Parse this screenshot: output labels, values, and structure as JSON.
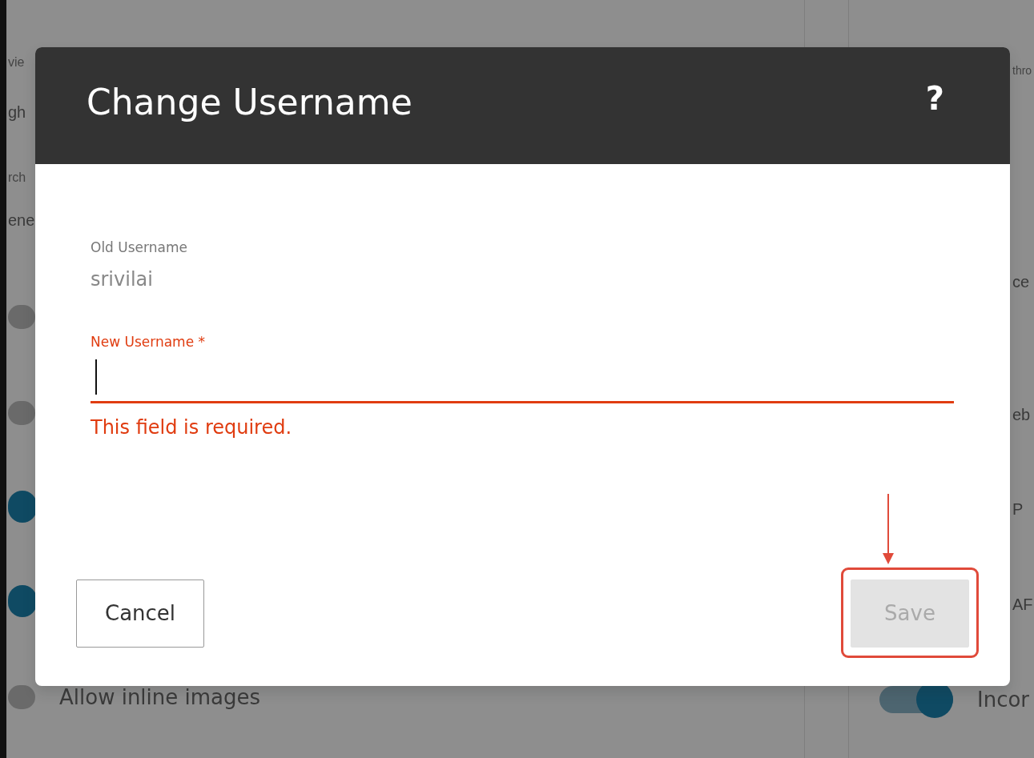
{
  "background": {
    "left_items": [
      {
        "kind": "caption",
        "text": "vie"
      },
      {
        "kind": "text",
        "text": "gh"
      },
      {
        "kind": "caption",
        "text": "rch"
      },
      {
        "kind": "text",
        "text": "ene"
      },
      {
        "kind": "toggle",
        "on": false
      },
      {
        "kind": "toggle",
        "on": false
      },
      {
        "kind": "toggle",
        "on": true
      },
      {
        "kind": "toggle",
        "on": true
      },
      {
        "kind": "toggle",
        "on": false,
        "label": "Allow inline images"
      }
    ],
    "right_items": [
      {
        "kind": "caption",
        "text": "thro"
      },
      {
        "kind": "text",
        "text": "ce"
      },
      {
        "kind": "text",
        "text": "eb"
      },
      {
        "kind": "text",
        "text": "P"
      },
      {
        "kind": "text",
        "text": "AF"
      },
      {
        "kind": "toggle",
        "on": true,
        "label": "Incor"
      }
    ]
  },
  "dialog": {
    "title": "Change Username",
    "help": "?",
    "fields": [
      {
        "kind": "readonly",
        "label": "Old Username",
        "value": "srivilai"
      },
      {
        "kind": "input",
        "label": "New Username *",
        "focused": true,
        "invalid": true,
        "error": "This field is required."
      }
    ],
    "buttons": [
      {
        "label": "Cancel",
        "kind": "secondary",
        "disabled": false,
        "highlighted": false
      },
      {
        "label": "Save",
        "kind": "primary",
        "disabled": true,
        "highlighted": true
      }
    ]
  }
}
